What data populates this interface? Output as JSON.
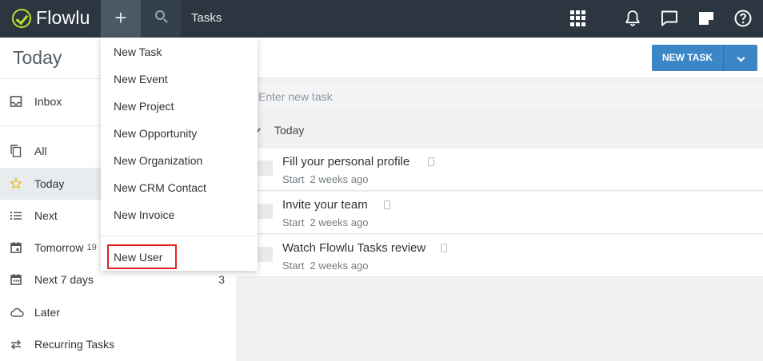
{
  "topbar": {
    "logo_text": "Flowlu",
    "plus_label": "+",
    "title": "Tasks",
    "brand_color": "#b6e02c",
    "icons": [
      "apps-grid-icon",
      "bell-icon",
      "chat-icon",
      "note-icon",
      "help-icon"
    ]
  },
  "sidebar": {
    "title": "Today",
    "items": [
      {
        "label": "Inbox",
        "icon": "inbox-icon",
        "count": ""
      },
      {
        "label": "All",
        "icon": "copy-icon",
        "count": ""
      },
      {
        "label": "Today",
        "icon": "star-icon",
        "count": ""
      },
      {
        "label": "Next",
        "icon": "list-icon",
        "count": ""
      },
      {
        "label": "Tomorrow",
        "icon": "calendar-icon",
        "count": "19"
      },
      {
        "label": "Next 7 days",
        "icon": "calendar-week-icon",
        "count": "3"
      },
      {
        "label": "Later",
        "icon": "cloud-icon",
        "count": ""
      },
      {
        "label": "Recurring Tasks",
        "icon": "repeat-icon",
        "count": ""
      }
    ]
  },
  "main": {
    "new_task_button": "NEW TASK",
    "new_task_placeholder": "Enter new task",
    "group_label": "Today",
    "tasks": [
      {
        "title": "Fill your personal profile",
        "meta_label": "Start",
        "meta_time": "2 weeks ago"
      },
      {
        "title": "Invite your team",
        "meta_label": "Start",
        "meta_time": "2 weeks ago"
      },
      {
        "title": "Watch Flowlu Tasks review",
        "meta_label": "Start",
        "meta_time": "2 weeks ago"
      }
    ]
  },
  "dropdown": {
    "items": [
      "New Task",
      "New Event",
      "New Project",
      "New Opportunity",
      "New Organization",
      "New CRM Contact",
      "New Invoice"
    ],
    "highlighted_item": "New User",
    "highlight_color": "#e32020"
  }
}
